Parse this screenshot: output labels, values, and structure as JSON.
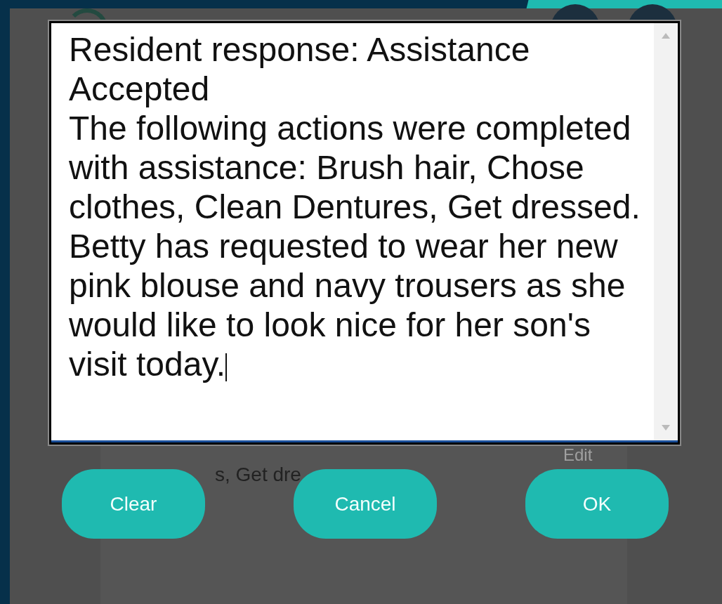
{
  "note_field": {
    "paragraphs": [
      "Resident response: Assistance Accepted",
      "The following actions were completed with assistance: Brush hair, Chose clothes, Clean Dentures, Get dressed.  Betty has requested to wear her new pink blouse and navy trousers as she would like to look nice for her son's visit today."
    ]
  },
  "background": {
    "note_fragment": "s, Get dre",
    "edit_link": "Edit"
  },
  "buttons": [
    {
      "label": "Clear"
    },
    {
      "label": "Cancel"
    },
    {
      "label": "OK"
    }
  ]
}
